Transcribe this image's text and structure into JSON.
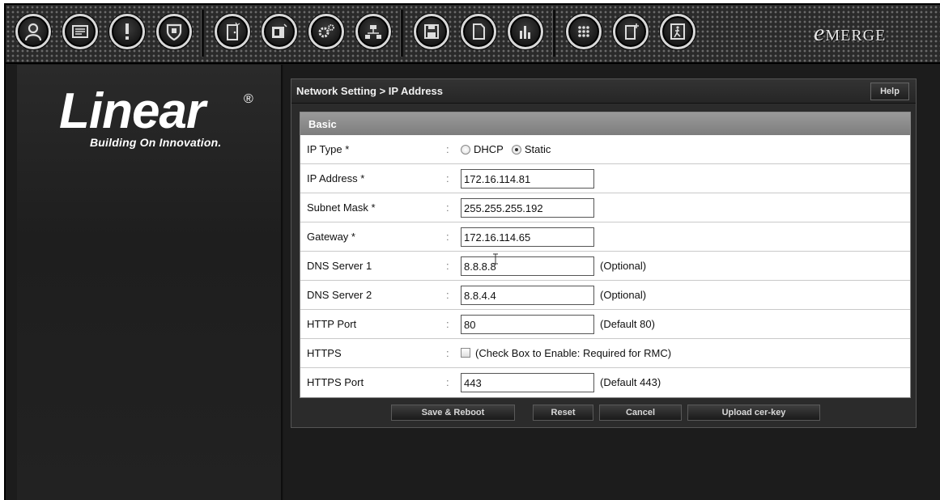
{
  "toolbar": {
    "brand_e": "e",
    "brand_rest": "MERGE",
    "icons": [
      "users-icon",
      "card-icon",
      "alert-icon",
      "shield-icon",
      "door-icon",
      "camera-door-icon",
      "settings-icon",
      "network-icon",
      "save-icon",
      "document-icon",
      "reports-icon",
      "keypad-icon",
      "add-door-icon",
      "exit-icon"
    ]
  },
  "sidebar": {
    "logo_word": "Linear",
    "logo_reg": "®",
    "logo_tagline": "Building On Innovation."
  },
  "panel": {
    "title": "Network Setting > IP Address",
    "help_label": "Help",
    "section_label": "Basic",
    "fields": {
      "ip_type": {
        "label": "IP Type *",
        "colon": ":",
        "option_dhcp": "DHCP",
        "option_static": "Static",
        "selected": "Static"
      },
      "ip_address": {
        "label": "IP Address *",
        "colon": ":",
        "value": "172.16.114.81"
      },
      "subnet_mask": {
        "label": "Subnet Mask *",
        "colon": ":",
        "value": "255.255.255.192"
      },
      "gateway": {
        "label": "Gateway *",
        "colon": ":",
        "value": "172.16.114.65"
      },
      "dns1": {
        "label": "DNS Server 1",
        "colon": ":",
        "value": "8.8.8.8",
        "note": "(Optional)"
      },
      "dns2": {
        "label": "DNS Server 2",
        "colon": ":",
        "value": "8.8.4.4",
        "note": "(Optional)"
      },
      "http_port": {
        "label": "HTTP Port",
        "colon": ":",
        "value": "80",
        "note": "(Default 80)"
      },
      "https": {
        "label": "HTTPS",
        "colon": ":",
        "checkbox_label": "(Check Box to Enable: Required for RMC)",
        "checked": false
      },
      "https_port": {
        "label": "HTTPS Port",
        "colon": ":",
        "value": "443",
        "note": "(Default 443)"
      }
    },
    "buttons": {
      "save_reboot": "Save & Reboot",
      "reset": "Reset",
      "cancel": "Cancel",
      "upload": "Upload cer-key"
    }
  }
}
